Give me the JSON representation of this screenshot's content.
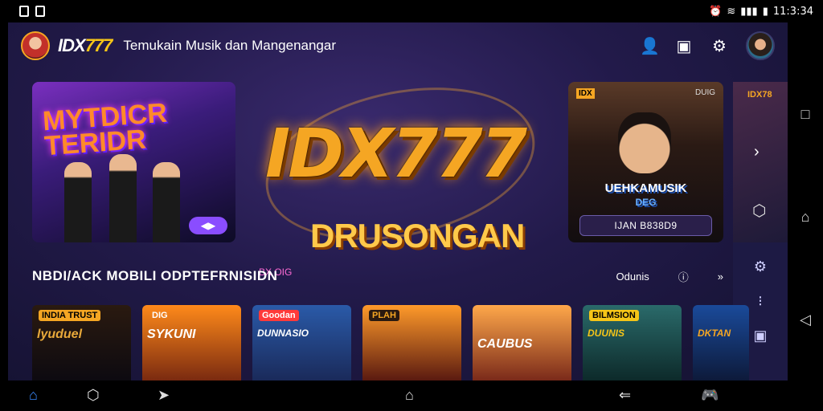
{
  "status_bar": {
    "time": "11:3:34"
  },
  "header": {
    "logo_main": "IDX",
    "logo_accent": "777",
    "tagline": "Temukain Musik dan Mangenangar",
    "icons": [
      "user-icon",
      "folder-icon",
      "gear-icon",
      "profile-avatar"
    ]
  },
  "hero": {
    "left_card": {
      "title": "MYTDICR TERIDR"
    },
    "center": {
      "title": "IDX777",
      "subtitle": "DRUSONGAN",
      "footnote": "BX OIG"
    },
    "right_card": {
      "badge": "IDX",
      "badge_right": "DUIG",
      "title": "UEHKAMUSIK",
      "subtitle": "DEG",
      "button": "IJAN B838D9"
    }
  },
  "side_panel": {
    "thumb_label": "IDX78"
  },
  "section": {
    "title": "NBDI/ACK MOBILI ODPTEFRNISIDN",
    "action_text": "Odunis"
  },
  "cards": [
    {
      "label": "INDIA TRUST",
      "title": "lyuduel",
      "color": "#e8a93a"
    },
    {
      "label": "DIG",
      "title": "SYKUNI",
      "color": "#ff7a1a"
    },
    {
      "label": "Goodan",
      "title": "DUNNASIO",
      "color": "#3aa8ff"
    },
    {
      "label": "PLAH",
      "title": "",
      "color": "#ff6a3a"
    },
    {
      "label": "",
      "title": "CAUBUS",
      "color": "#ffb84a"
    },
    {
      "label": "BILMSION",
      "title": "DUUNIS",
      "color": "#3ac0a0"
    },
    {
      "label": "",
      "title": "DKTAN",
      "color": "#2a8aff"
    }
  ],
  "colors": {
    "accent": "#f5a623",
    "background": "#221a4a",
    "highlight": "#8a4dff"
  }
}
